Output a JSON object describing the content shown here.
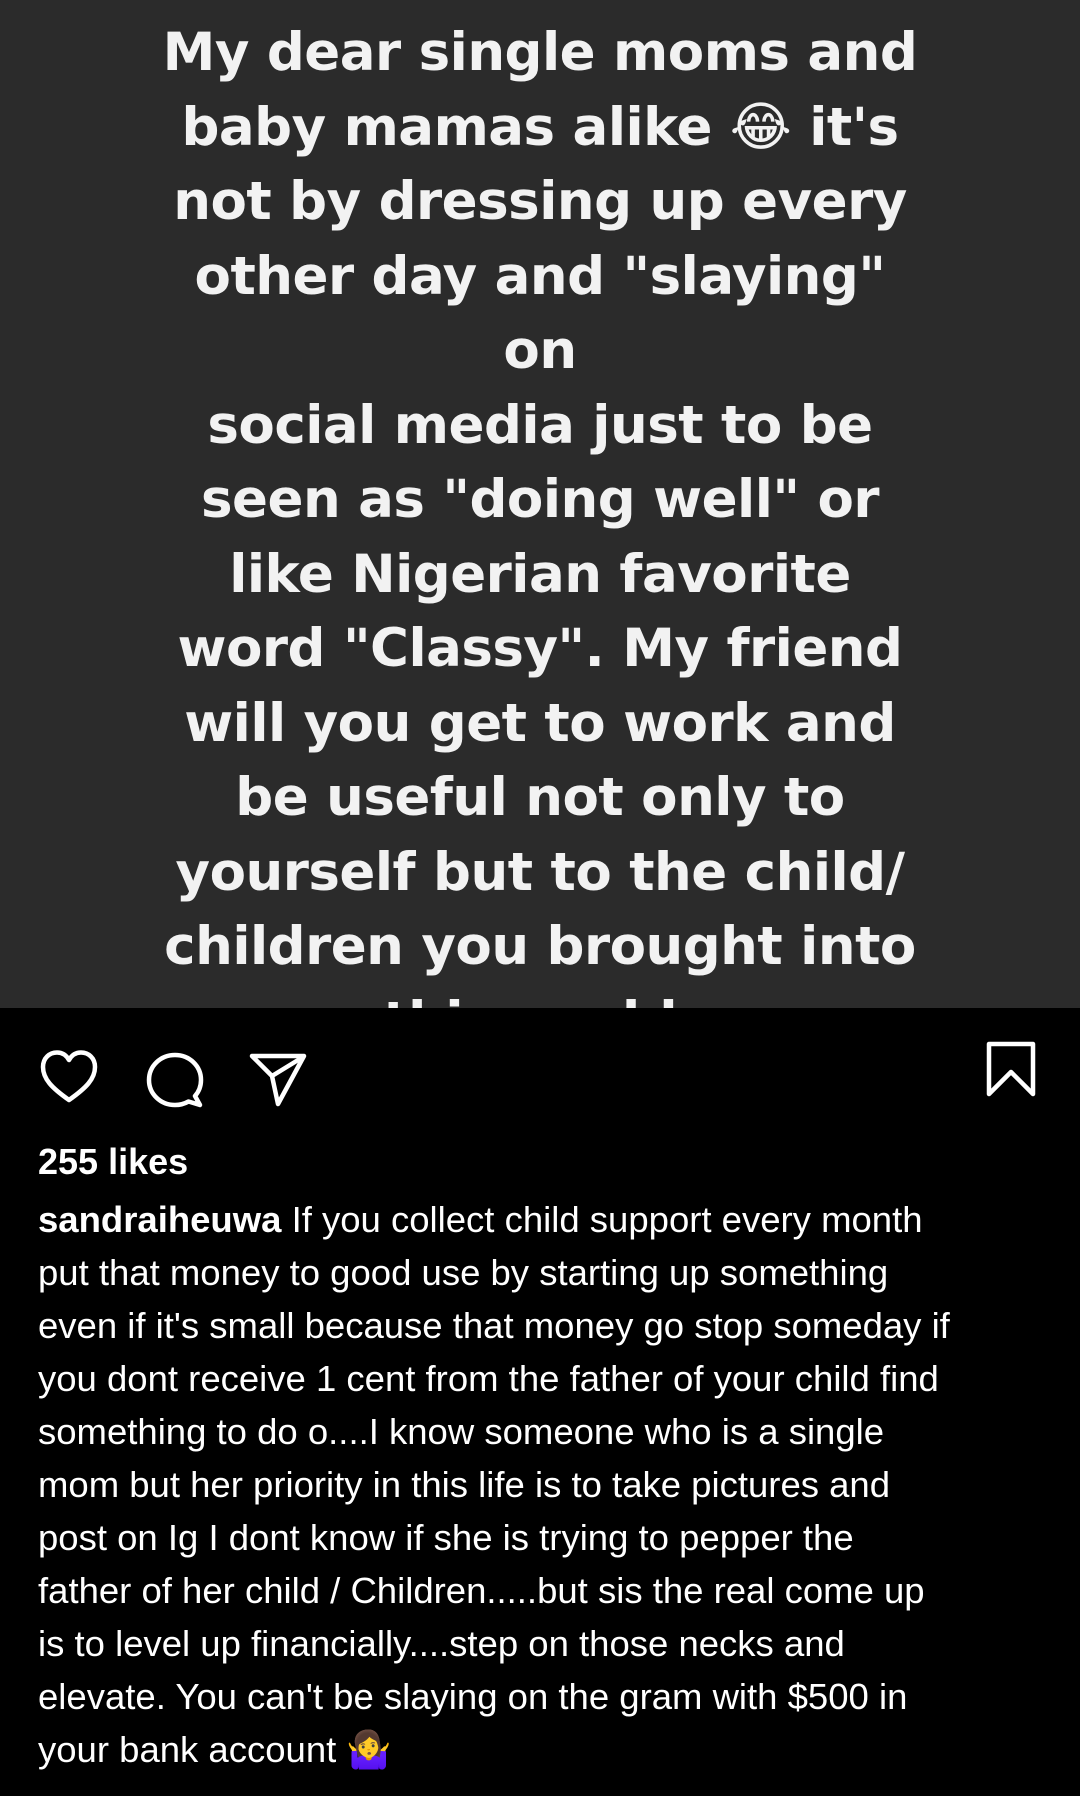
{
  "post": {
    "image_text": "My dear single moms and\nbaby mamas alike 😂 it's\nnot by dressing up every\nother day and \"slaying\" on\nsocial media just to be\nseen as \"doing well\" or\nlike Nigerian favorite\nword \"Classy\". My friend\nwill you get to work and\nbe useful not only to\nyourself but to the child/\nchildren you brought into\nthis world.",
    "likes": "255 likes",
    "username": "sandraiheuwa",
    "caption": "If you collect child support every month\nput that money to good use by starting up something\neven if it's small because that money go stop someday if\nyou dont receive 1 cent from the father of your child find\nsomething to do o....I know someone who is a single\nmom but her priority in this life is to take pictures and\npost on Ig I dont know if she is trying to pepper the\nfather of her child / Children.....but sis the real come up\nis to level up financially....step on those necks and\nelevate. You can't be slaying on the gram with $500 in\nyour bank account 🤷‍♀️"
  },
  "icons": {
    "like": "heart-icon",
    "comment": "comment-bubble-icon",
    "share": "paper-plane-icon",
    "save": "bookmark-icon"
  },
  "colors": {
    "image_background": "#2b2b2b",
    "page_background": "#000000",
    "text": "#ffffff"
  }
}
